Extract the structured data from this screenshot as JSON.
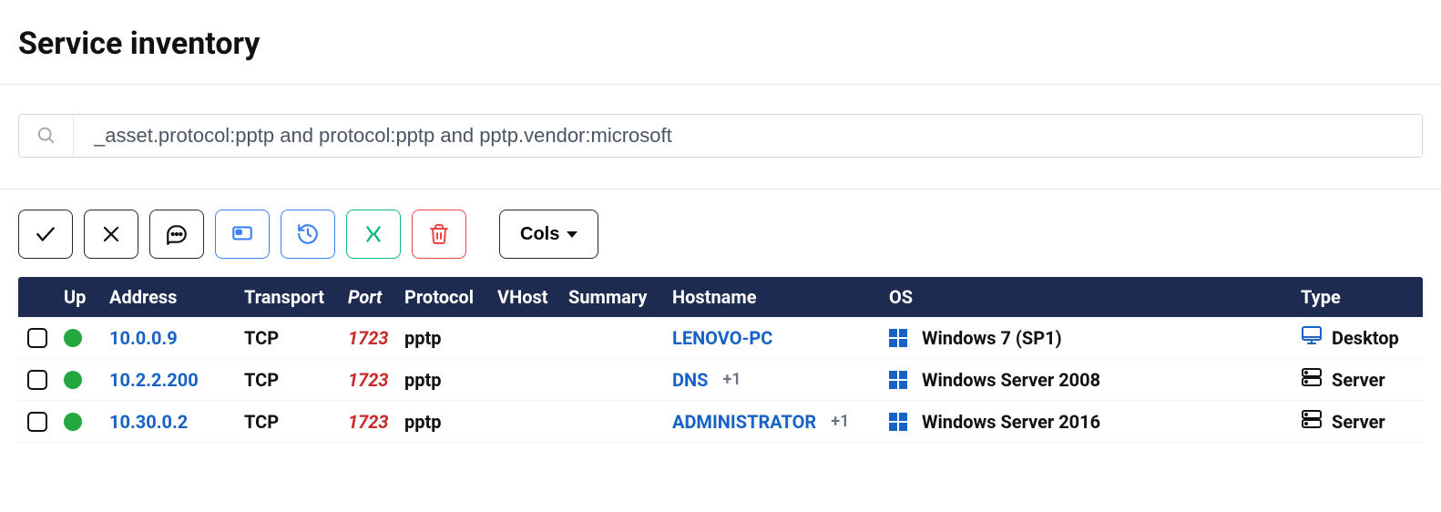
{
  "page": {
    "title": "Service inventory"
  },
  "search": {
    "query": "_asset.protocol:pptp and protocol:pptp and pptp.vendor:microsoft",
    "placeholder": ""
  },
  "toolbar": {
    "cols_label": "Cols"
  },
  "columns": {
    "up": "Up",
    "address": "Address",
    "transport": "Transport",
    "port": "Port",
    "protocol": "Protocol",
    "vhost": "VHost",
    "summary": "Summary",
    "hostname": "Hostname",
    "os": "OS",
    "type": "Type"
  },
  "rows": [
    {
      "up": true,
      "address": "10.0.0.9",
      "transport": "TCP",
      "port": "1723",
      "protocol": "pptp",
      "vhost": "",
      "summary": "",
      "hostname": "LENOVO-PC",
      "hostname_extra": "",
      "os": "Windows 7 (SP1)",
      "type": "Desktop",
      "type_icon": "desktop"
    },
    {
      "up": true,
      "address": "10.2.2.200",
      "transport": "TCP",
      "port": "1723",
      "protocol": "pptp",
      "vhost": "",
      "summary": "",
      "hostname": "DNS",
      "hostname_extra": "+1",
      "os": "Windows Server 2008",
      "type": "Server",
      "type_icon": "server"
    },
    {
      "up": true,
      "address": "10.30.0.2",
      "transport": "TCP",
      "port": "1723",
      "protocol": "pptp",
      "vhost": "",
      "summary": "",
      "hostname": "ADMINISTRATOR",
      "hostname_extra": "+1",
      "os": "Windows Server 2016",
      "type": "Server",
      "type_icon": "server"
    }
  ]
}
